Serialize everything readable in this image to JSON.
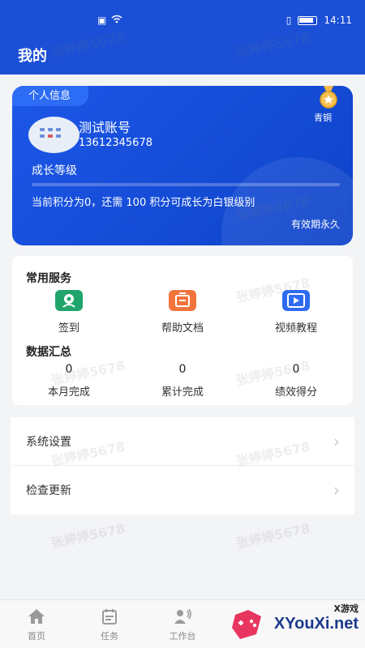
{
  "status_bar": {
    "time": "14:11"
  },
  "header": {
    "title": "我的"
  },
  "profile": {
    "tab_label": "个人信息",
    "username": "测试账号",
    "phone": "13612345678",
    "growth_title": "成长等级",
    "points_text": "当前积分为0，还需 100 积分可成长为白银级别",
    "progress": 0,
    "valid_text": "有效期永久",
    "medal_label": "青铜",
    "accent": "#1a4fd6"
  },
  "services": {
    "title": "常用服务",
    "items": [
      {
        "label": "签到",
        "icon": "sign-in-icon",
        "color": "#1fa56b"
      },
      {
        "label": "帮助文档",
        "icon": "help-doc-icon",
        "color": "#f2743b"
      },
      {
        "label": "视频教程",
        "icon": "video-icon",
        "color": "#2f6bf0"
      }
    ]
  },
  "stats": {
    "title": "数据汇总",
    "items": [
      {
        "value": "0",
        "label": "本月完成"
      },
      {
        "value": "0",
        "label": "累计完成"
      },
      {
        "value": "0",
        "label": "绩效得分"
      }
    ]
  },
  "settings": {
    "items": [
      {
        "label": "系统设置"
      },
      {
        "label": "检查更新"
      }
    ]
  },
  "watermark": "张婷婷5678",
  "bottom_nav": {
    "items": [
      {
        "label": "首页",
        "icon": "home-icon"
      },
      {
        "label": "任务",
        "icon": "task-icon"
      },
      {
        "label": "工作台",
        "icon": "workbench-icon"
      }
    ]
  },
  "site_logo": {
    "top": "X游戏",
    "brand": "XYouXi.net"
  }
}
